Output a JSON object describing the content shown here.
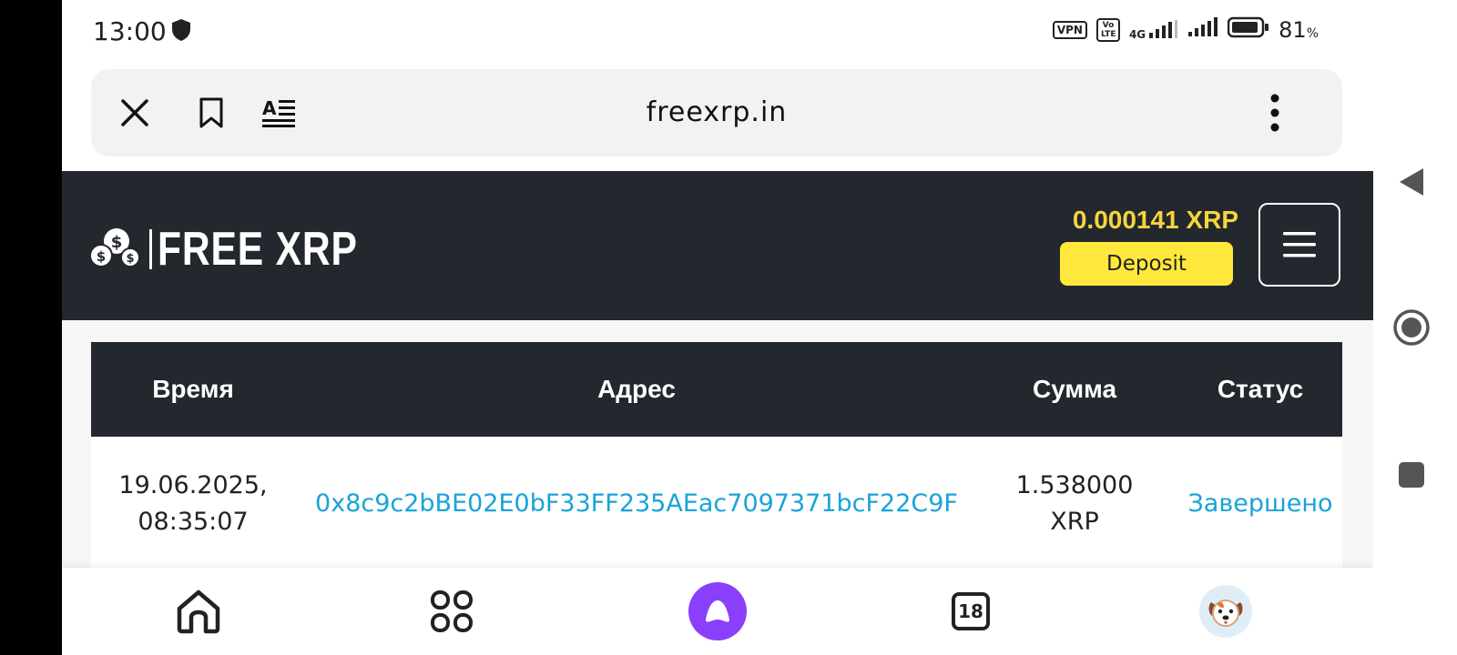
{
  "status_bar": {
    "time": "13:00",
    "vpn": "VPN",
    "volte": "Vo LTE",
    "network": "4G",
    "battery_percent": "81",
    "battery_unit": "%"
  },
  "browser": {
    "url": "freexrp.in",
    "icons": [
      "close-icon",
      "bookmark-icon",
      "reader-mode-icon",
      "more-vert-icon"
    ]
  },
  "site": {
    "logo_text": "FREE XRP",
    "balance": "0.000141 XRP",
    "deposit_label": "Deposit",
    "accent_color": "#ffe83b",
    "header_color": "#23272e"
  },
  "table": {
    "headers": [
      "Время",
      "Адрес",
      "Сумма",
      "Статус"
    ],
    "rows": [
      {
        "time_line1": "19.06.2025,",
        "time_line2": "08:35:07",
        "address": "0x8c9c2bBE02E0bF33FF235AEac7097371bcF22C9F",
        "amount_line1": "1.538000",
        "amount_line2": "XRP",
        "status": "Завершено"
      }
    ]
  },
  "bottom_bar": {
    "tabs_count": "18",
    "icons": [
      "home-icon",
      "services-grid-icon",
      "alice-assistant-icon",
      "tabs-icon",
      "profile-avatar"
    ]
  }
}
